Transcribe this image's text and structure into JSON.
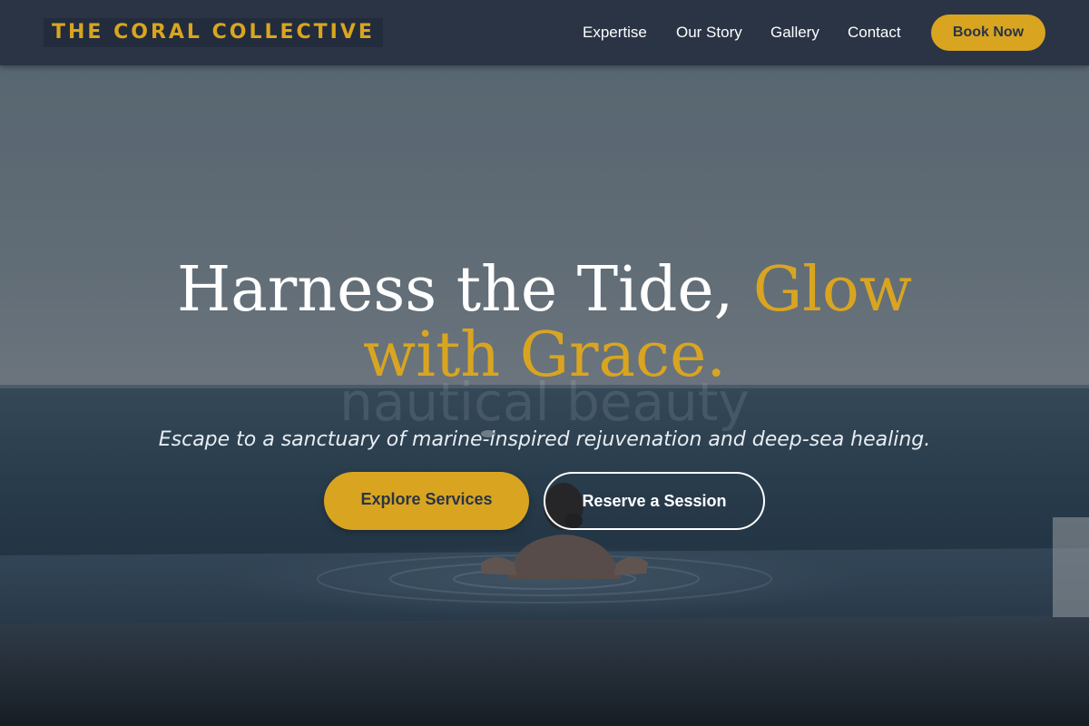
{
  "brand": {
    "name": "THE CORAL COLLECTIVE"
  },
  "nav": {
    "items": [
      {
        "label": "Expertise"
      },
      {
        "label": "Our Story"
      },
      {
        "label": "Gallery"
      },
      {
        "label": "Contact"
      }
    ],
    "cta_label": "Book Now"
  },
  "hero": {
    "headline_white": "Harness the Tide,",
    "headline_accent_1": "Glow",
    "headline_accent_2": "with Grace.",
    "ghost_text": "nautical beauty",
    "tagline": "Escape to a sanctuary of marine-inspired rejuvenation and deep-sea healing.",
    "primary_button": "Explore Services",
    "secondary_button": "Reserve a Session"
  },
  "colors": {
    "accent": "#d9a520",
    "nav_background": "#2a3445",
    "text_light": "#ffffff"
  }
}
